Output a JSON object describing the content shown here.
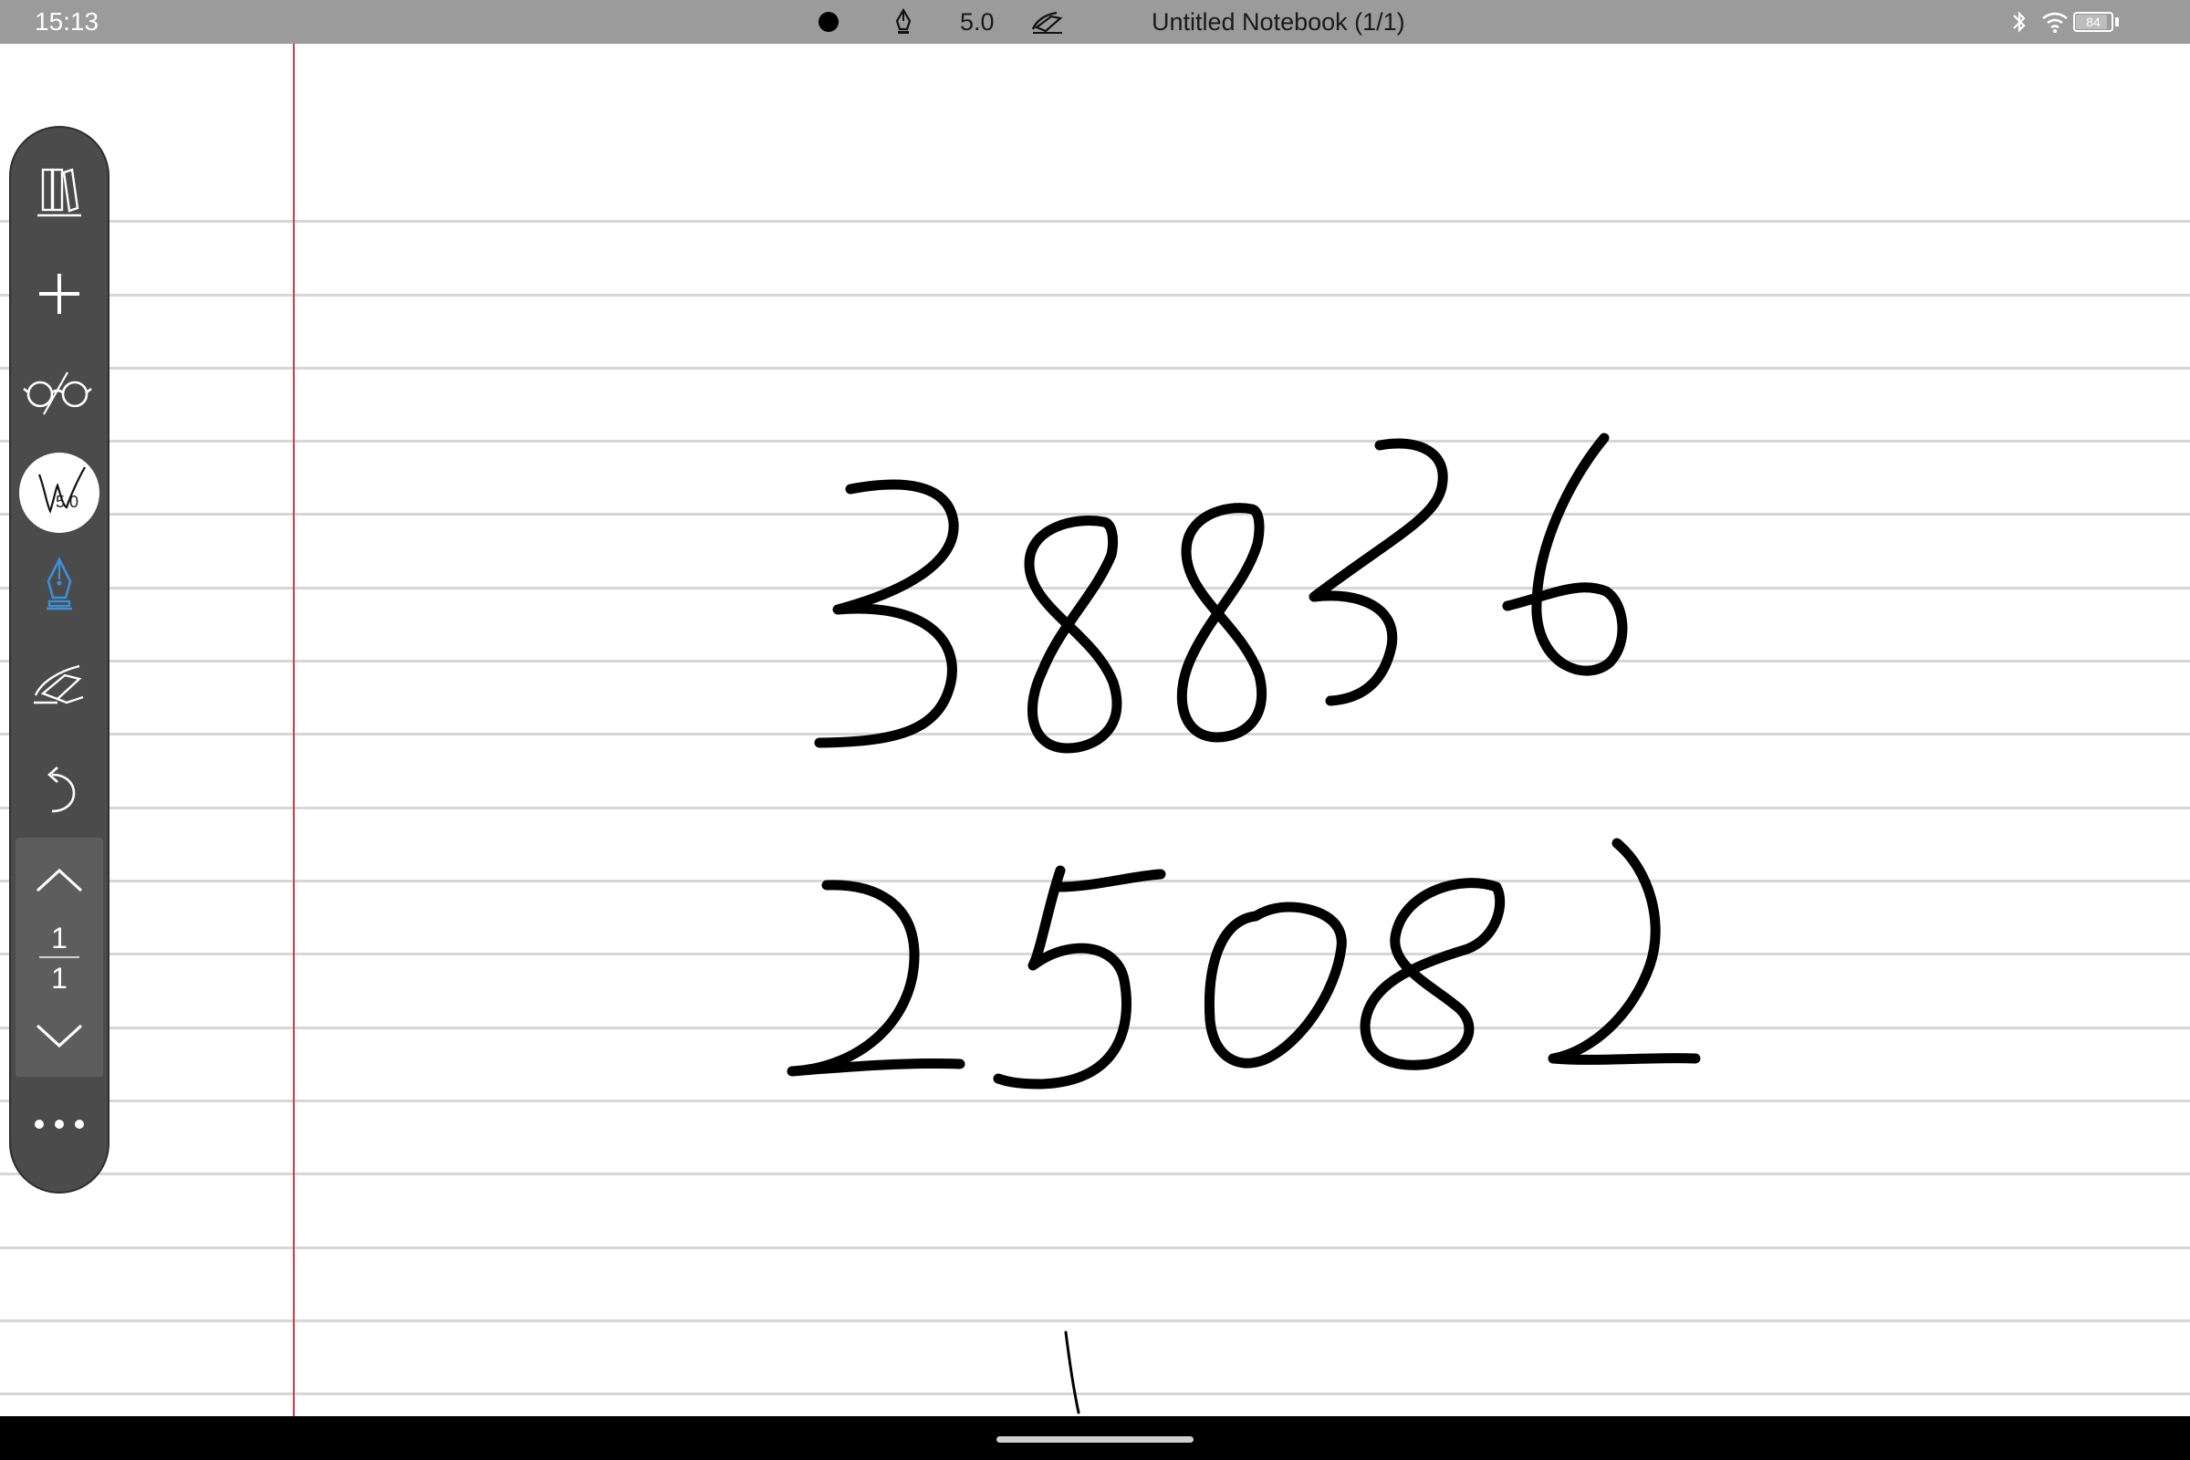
{
  "status_bar": {
    "time": "15:13",
    "stroke_size": "5.0",
    "title": "Untitled Notebook (1/1)",
    "battery": "84",
    "icons": [
      "record-dot-icon",
      "fountain-pen-icon",
      "eraser-hand-icon",
      "bluetooth-icon",
      "wifi-icon",
      "battery-icon"
    ]
  },
  "toolbar": {
    "pen_size": "5.0",
    "current_page": "1",
    "total_pages": "1",
    "pen_color": "#3d8fd8",
    "icons": [
      "library-icon",
      "add-icon",
      "read-mode-icon",
      "pen-style-icon",
      "fountain-pen-icon",
      "eraser-icon",
      "undo-icon",
      "chevron-up-icon",
      "chevron-down-icon",
      "more-icon"
    ]
  },
  "canvas": {
    "handwriting_line_1": "38836",
    "handwriting_line_2": "25082",
    "margin_color": "#d83a47",
    "rule_color": "#d6d6d6"
  }
}
